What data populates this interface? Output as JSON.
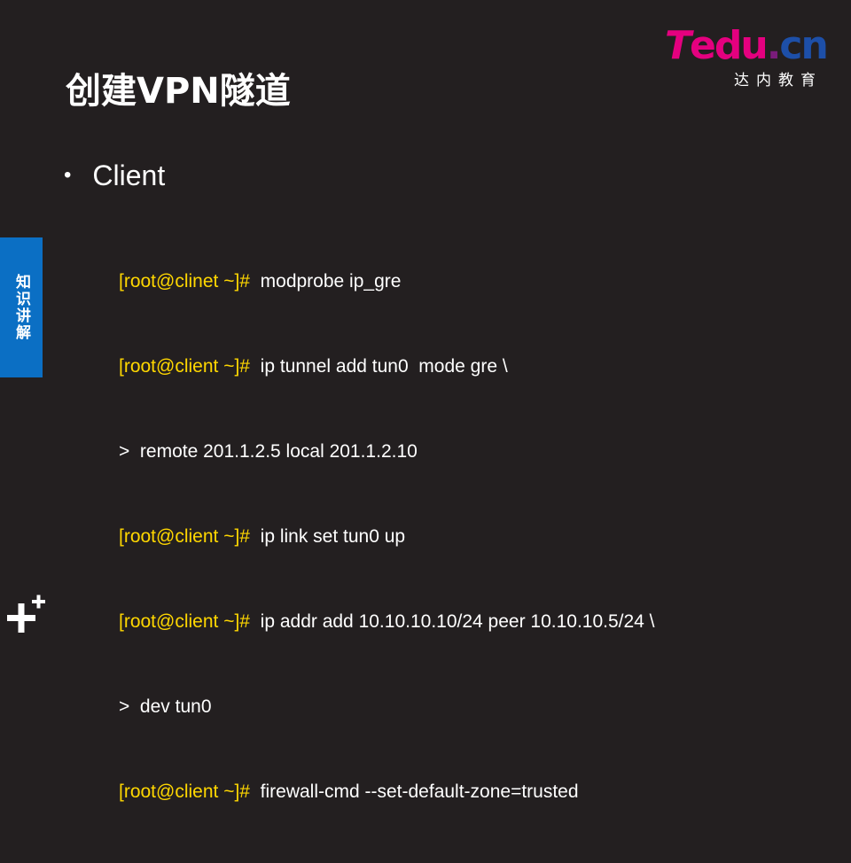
{
  "slide": {
    "title": "创建VPN隧道",
    "logo": {
      "t": "T",
      "edu": "edu",
      "dot": ".",
      "cn": "cn",
      "subtitle": "达内教育"
    },
    "side_tab": "知识讲解",
    "bullet": {
      "symbol": "•",
      "text": "Client"
    },
    "code_lines": [
      {
        "prompt": "[root@clinet ~]#",
        "command": "  modprobe ip_gre"
      },
      {
        "prompt": "[root@client ~]#",
        "command": "  ip tunnel add tun0  mode gre \\"
      },
      {
        "prompt": "",
        "command": ">  remote 201.1.2.5 local 201.1.2.10"
      },
      {
        "prompt": "[root@client ~]#",
        "command": "  ip link set tun0 up"
      },
      {
        "prompt": "[root@client ~]#",
        "command": "  ip addr add 10.10.10.10/24 peer 10.10.10.5/24 \\"
      },
      {
        "prompt": "",
        "command": ">  dev tun0"
      },
      {
        "prompt": "[root@client ~]#",
        "command": "  firewall-cmd --set-default-zone=trusted"
      }
    ],
    "colors": {
      "background": "#231f20",
      "prompt": "#ffd700",
      "text": "#ffffff",
      "side_tab": "#0b6fc4",
      "brand_pink": "#e4007f",
      "brand_blue": "#1d4fa8"
    },
    "icons": {
      "footer": "plus-icon"
    }
  }
}
